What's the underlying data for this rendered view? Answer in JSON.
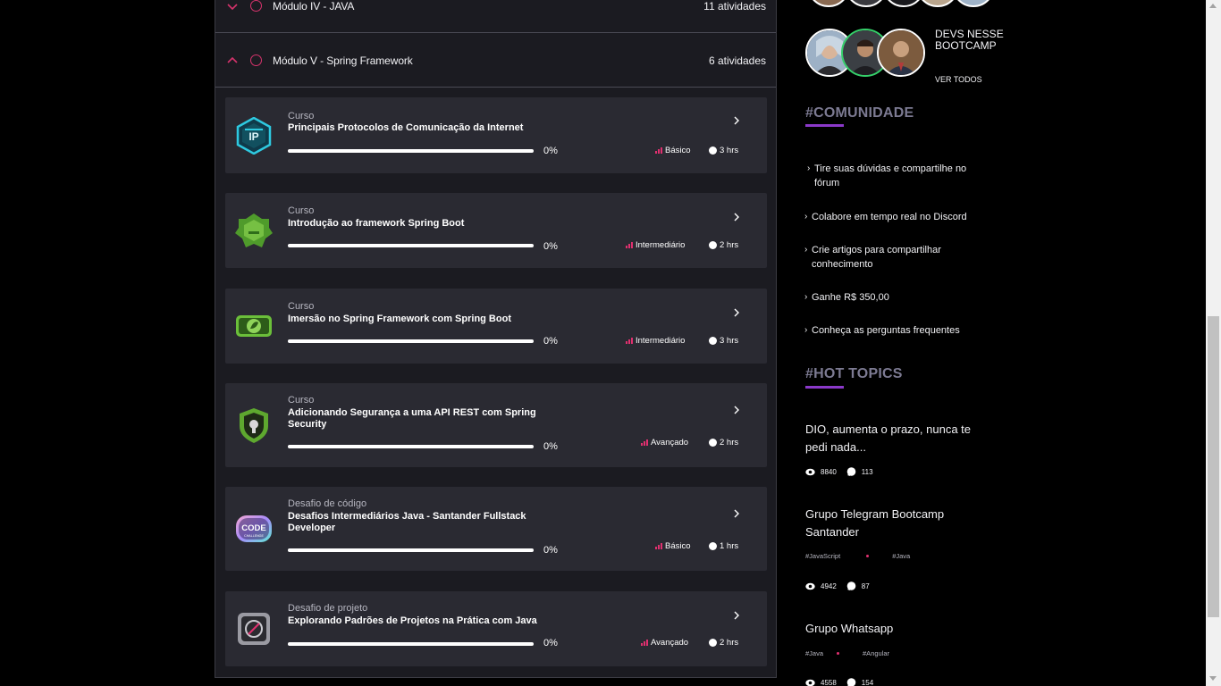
{
  "modules": [
    {
      "title": "Módulo IV - JAVA",
      "count": "11 atividades",
      "expanded": false
    },
    {
      "title": "Módulo V - Spring Framework",
      "count": "6 atividades",
      "expanded": true
    }
  ],
  "cards": [
    {
      "type": "Curso",
      "title": "Principais Protocolos de Comunicação da Internet",
      "progress": "0%",
      "level": "Básico",
      "hours": "3 hrs",
      "badge": "ip-protocol-badge-icon"
    },
    {
      "type": "Curso",
      "title": "Introdução ao framework Spring Boot",
      "progress": "0%",
      "level": "Intermediário",
      "hours": "2 hrs",
      "badge": "spring-boot-badge-icon"
    },
    {
      "type": "Curso",
      "title": "Imersão no Spring Framework com Spring Boot",
      "progress": "0%",
      "level": "Intermediário",
      "hours": "3 hrs",
      "badge": "spring-framework-badge-icon"
    },
    {
      "type": "Curso",
      "title": "Adicionando Segurança a uma API REST com Spring Security",
      "progress": "0%",
      "level": "Avançado",
      "hours": "2 hrs",
      "badge": "spring-security-shield-icon"
    },
    {
      "type": "Desafio de código",
      "title": "Desafios Intermediários Java - Santander Fullstack Developer",
      "progress": "0%",
      "level": "Básico",
      "hours": "1 hrs",
      "badge": "code-challenge-badge-icon",
      "badge_text": "CODE",
      "badge_subtext": "CHALLENGE"
    },
    {
      "type": "Desafio de projeto",
      "title": "Explorando Padrões de Projetos na Prática com Java",
      "progress": "0%",
      "level": "Avançado",
      "hours": "2 hrs",
      "badge": "project-challenge-badge-icon"
    }
  ],
  "sidebar": {
    "devs_label": "DEVS NESSE BOOTCAMP",
    "ver_todos": "VER TODOS",
    "community_title": "#COMUNIDADE",
    "community_items": [
      "Tire suas dúvidas e compartilhe no fórum",
      "Colabore em tempo real no Discord",
      "Crie artigos para compartilhar conhecimento",
      "Ganhe R$ 350,00",
      "Conheça as perguntas frequentes"
    ],
    "hot_title": "#HOT TOPICS",
    "topics": [
      {
        "title": "DIO, aumenta o prazo, nunca te pedi nada...",
        "views": "8840",
        "comments": "113",
        "tags": []
      },
      {
        "title": "Grupo Telegram Bootcamp Santander",
        "views": "4942",
        "comments": "87",
        "tags": [
          "#JavaScript",
          "#Java"
        ]
      },
      {
        "title": "Grupo Whatsapp",
        "views": "4558",
        "comments": "154",
        "tags": [
          "#Java",
          "#Angular"
        ]
      }
    ]
  },
  "colors": {
    "accent_pink": "#e0306f",
    "accent_purple": "#8b39c9",
    "card_bg": "#2a2a32",
    "online": "#35d06a"
  }
}
